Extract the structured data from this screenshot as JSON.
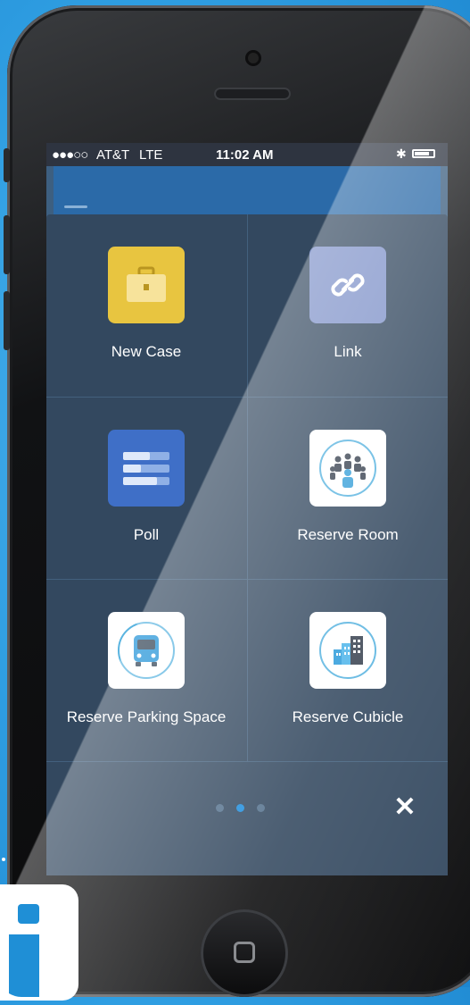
{
  "status": {
    "signal": "●●●○○",
    "carrier": "AT&T",
    "network": "LTE",
    "time": "11:02 AM"
  },
  "actions": [
    {
      "label": "New Case",
      "icon": "briefcase-icon",
      "color": "#e8c540"
    },
    {
      "label": "Link",
      "icon": "link-icon",
      "color": "#7f92c9"
    },
    {
      "label": "Poll",
      "icon": "poll-icon",
      "color": "#3f6fc7"
    },
    {
      "label": "Reserve Room",
      "icon": "meeting-room-icon",
      "color": "#ffffff"
    },
    {
      "label": "Reserve Parking Space",
      "icon": "bus-icon",
      "color": "#ffffff"
    },
    {
      "label": "Reserve Cubicle",
      "icon": "buildings-icon",
      "color": "#ffffff"
    }
  ],
  "pager": {
    "total": 3,
    "active": 2
  },
  "close_glyph": "✕"
}
